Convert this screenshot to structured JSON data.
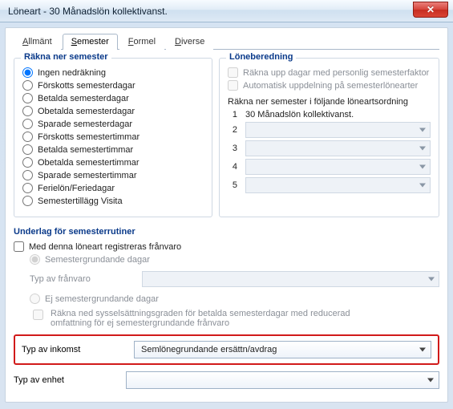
{
  "window": {
    "title": "Löneart - 30  Månadslön kollektivanst.",
    "close_label": "✕"
  },
  "tabs": {
    "t0": "Allmänt",
    "t0_u": "A",
    "t1": "Semester",
    "t1_u": "S",
    "t2": "Formel",
    "t2_u": "F",
    "t3": "Diverse",
    "t3_u": "D"
  },
  "left_group": {
    "title": "Räkna ner semester",
    "options": {
      "o0": "Ingen nedräkning",
      "o1": "Förskotts semesterdagar",
      "o2": "Betalda semesterdagar",
      "o3": "Obetalda semesterdagar",
      "o4": "Sparade semesterdagar",
      "o5": "Förskotts semestertimmar",
      "o6": "Betalda semestertimmar",
      "o7": "Obetalda semestertimmar",
      "o8": "Sparade semestertimmar",
      "o9": "Ferielön/Feriedagar",
      "o10": "Semestertillägg Visita"
    }
  },
  "right_group": {
    "title": "Löneberedning",
    "c0": "Räkna upp dagar med personlig semesterfaktor",
    "c1": "Automatisk uppdelning på semesterlönearter",
    "order_hdr": "Räkna ner semester i följande löneartsordning",
    "row1_num": "1",
    "row1_val": "30 Månadslön kollektivanst.",
    "row2_num": "2",
    "row3_num": "3",
    "row4_num": "4",
    "row5_num": "5"
  },
  "underlag": {
    "title": "Underlag för semesterrutiner",
    "c_main": "Med denna löneart registreras frånvaro",
    "r0": "Semestergrundande dagar",
    "typ_franvaro_lbl": "Typ av frånvaro",
    "r1": "Ej semestergrundande dagar",
    "c_sub": "Räkna ned sysselsättningsgraden för betalda semesterdagar med reducerad omfattning för ej semestergrundande frånvaro",
    "inkomst_lbl": "Typ av inkomst",
    "inkomst_val": "Semlönegrundande ersättn/avdrag",
    "enhet_lbl": "Typ av enhet"
  }
}
